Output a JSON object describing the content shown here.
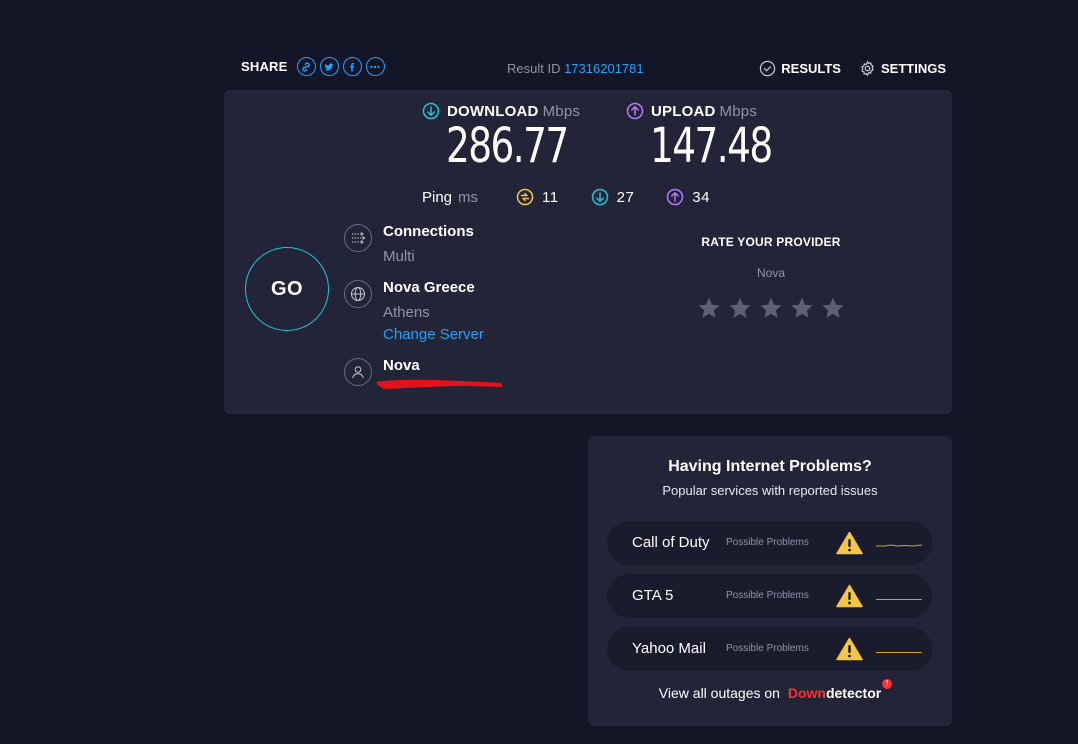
{
  "topbar": {
    "share_label": "SHARE",
    "share_buttons": [
      "link-icon",
      "twitter-icon",
      "facebook-icon",
      "more-icon"
    ],
    "result_label": "Result ID",
    "result_id": "17316201781",
    "results_label": "RESULTS",
    "settings_label": "SETTINGS"
  },
  "download": {
    "label": "DOWNLOAD",
    "unit": "Mbps",
    "value": "286.77",
    "color": "#1fc5d4"
  },
  "upload": {
    "label": "UPLOAD",
    "unit": "Mbps",
    "value": "147.48",
    "color": "#b57bff"
  },
  "ping": {
    "label": "Ping",
    "unit": "ms",
    "idle": "11",
    "download": "27",
    "upload": "34",
    "idle_color": "#f5c645"
  },
  "go": {
    "label": "GO"
  },
  "connections": {
    "title": "Connections",
    "value": "Multi"
  },
  "server": {
    "title": "Nova Greece",
    "location": "Athens",
    "change_label": "Change Server"
  },
  "provider": {
    "title": "Nova"
  },
  "rate": {
    "title": "RATE YOUR PROVIDER",
    "provider": "Nova",
    "stars": 5,
    "rating": 0
  },
  "downdetector": {
    "title": "Having Internet Problems?",
    "subtitle": "Popular services with reported issues",
    "services": [
      {
        "name": "Call of Duty",
        "status": "Possible Problems"
      },
      {
        "name": "GTA 5",
        "status": "Possible Problems"
      },
      {
        "name": "Yahoo Mail",
        "status": "Possible Problems"
      }
    ],
    "footer": "View all outages on",
    "brand_red": "Down",
    "brand_white": "detector",
    "brand_color": "#ff3030"
  },
  "colors": {
    "background": "#141526",
    "card": "#232437",
    "accent_blue": "#1fa3ff",
    "warning": "#f5c645"
  }
}
